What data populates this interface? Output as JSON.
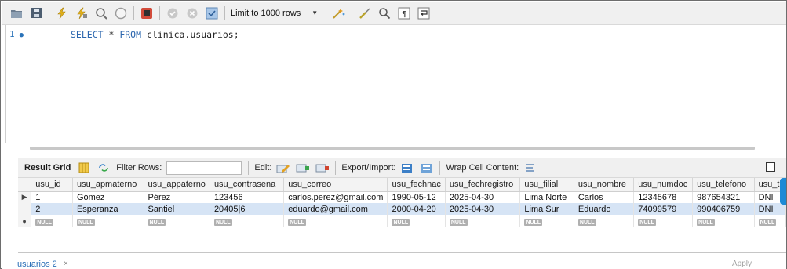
{
  "toolbar": {
    "icons": [
      "folder-open-icon",
      "save-icon",
      "execute-icon",
      "execute-current-icon",
      "explain-icon",
      "stop-icon",
      "toggle-continue-icon",
      "commit-icon",
      "rollback-icon",
      "autocommit-icon",
      "beautify-icon",
      "find-icon",
      "invisible-chars-icon",
      "wrap-icon"
    ],
    "limit_label": "Limit to 1000 rows"
  },
  "editor": {
    "line_number": "1",
    "code_keyword1": "SELECT",
    "code_mid": " * ",
    "code_keyword2": "FROM",
    "code_rest": " clinica.usuarios;"
  },
  "result_toolbar": {
    "tab_label": "Result Grid",
    "filter_label": "Filter Rows:",
    "edit_label": "Edit:",
    "export_label": "Export/Import:",
    "wrap_label": "Wrap Cell Content:"
  },
  "grid": {
    "columns": [
      "usu_id",
      "usu_apmaterno",
      "usu_appaterno",
      "usu_contrasena",
      "usu_correo",
      "usu_fechnac",
      "usu_fechregistro",
      "usu_filial",
      "usu_nombre",
      "usu_numdoc",
      "usu_telefono",
      "usu_ti"
    ],
    "rows": [
      [
        "1",
        "Gómez",
        "Pérez",
        "123456",
        "carlos.perez@gmail.com",
        "1990-05-12",
        "2025-04-30",
        "Lima Norte",
        "Carlos",
        "12345678",
        "987654321",
        "DNI"
      ],
      [
        "2",
        "Esperanza",
        "Santiel",
        "20405|6",
        "eduardo@gmail.com",
        "2000-04-20",
        "2025-04-30",
        "Lima Sur",
        "Eduardo",
        "74099579",
        "990406759",
        "DNI"
      ]
    ],
    "null_label": "NULL"
  },
  "bottom": {
    "tab_label": "usuarios 2",
    "close_glyph": "×",
    "apply_label": "Apply"
  },
  "colors": {
    "accent_blue": "#1d8ad6",
    "keyword_blue": "#2b66ae",
    "selected_row": "#d6e4f5"
  }
}
